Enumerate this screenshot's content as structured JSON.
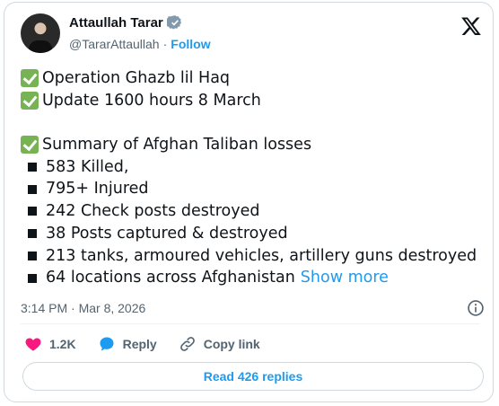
{
  "author": {
    "display_name": "Attaullah Tarar",
    "handle": "@TararAttaullah",
    "separator": "·",
    "follow_label": "Follow"
  },
  "tweet": {
    "line1": "Operation Ghazb lil Haq",
    "line2": "Update 1600 hours 8 March",
    "line3": "Summary of Afghan Taliban losses",
    "bullets": [
      "583 Killed,",
      "795+ Injured",
      "242 Check posts destroyed",
      "38 Posts captured & destroyed",
      "213 tanks, armoured vehicles, artillery guns destroyed",
      "64 locations across Afghanistan"
    ],
    "show_more": "Show more"
  },
  "meta": {
    "timestamp": "3:14 PM · Mar 8, 2026"
  },
  "actions": {
    "like_count": "1.2K",
    "reply_label": "Reply",
    "copy_link_label": "Copy link"
  },
  "replies_button": "Read 426 replies",
  "colors": {
    "accent": "#1d9bf0",
    "like": "#f91880",
    "check": "#77b255",
    "verified": "#829aab"
  },
  "icons": [
    "verified-badge-icon",
    "x-logo-icon",
    "check-mark-icon",
    "info-icon",
    "heart-icon",
    "reply-bubble-icon",
    "link-icon"
  ]
}
